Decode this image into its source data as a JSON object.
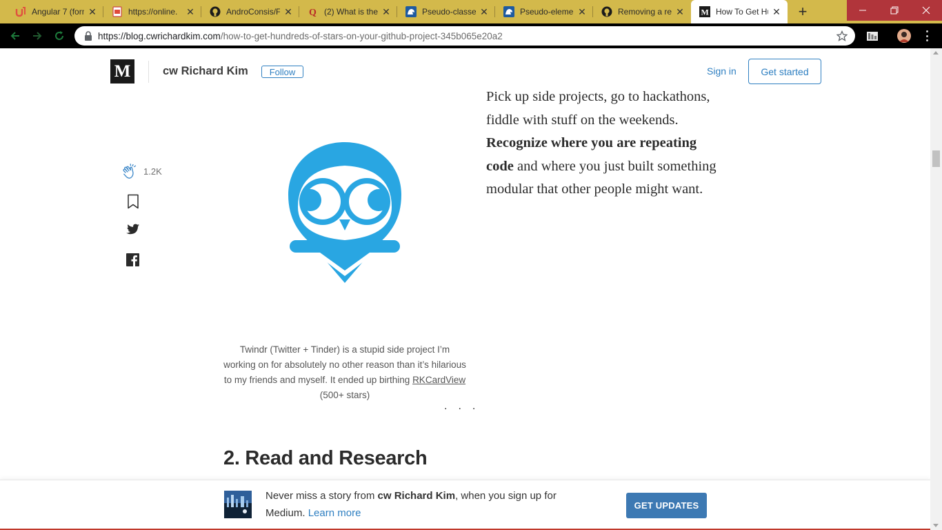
{
  "browser": {
    "tabs": [
      {
        "label": "Angular 7 (form",
        "favicon": "udemy-icon",
        "active": false
      },
      {
        "label": "https://online.",
        "favicon": "pdf-icon",
        "active": false
      },
      {
        "label": "AndroConsis/F",
        "favicon": "github-icon",
        "active": false
      },
      {
        "label": "(2) What is the",
        "favicon": "quora-icon",
        "active": false
      },
      {
        "label": "Pseudo-classes",
        "favicon": "mdn-icon",
        "active": false
      },
      {
        "label": "Pseudo-eleme",
        "favicon": "mdn-icon",
        "active": false
      },
      {
        "label": "Removing a re",
        "favicon": "github-icon",
        "active": false
      },
      {
        "label": "How To Get Hu",
        "favicon": "medium-icon",
        "active": true
      }
    ],
    "url_host": "https://blog.cwrichardkim.com",
    "url_path": "/how-to-get-hundreds-of-stars-on-your-github-project-345b065e20a2",
    "colors": {
      "tabstrip": "#d3b94b",
      "toolbar": "#000000",
      "window_controls": "#b1353b"
    }
  },
  "header": {
    "logo_letter": "M",
    "publication": "cw Richard Kim",
    "follow_label": "Follow",
    "signin_label": "Sign in",
    "getstarted_label": "Get started"
  },
  "rail": {
    "clap_count": "1.2K"
  },
  "article": {
    "body_p1": "Pick up side projects, go to hackathons, fiddle with stuff on the weekends.",
    "body_bold": "Recognize where you are repeating code",
    "body_p2": "and where you just built something modular that other people might want.",
    "caption_line": "Twindr (Twitter + Tinder) is a stupid side project I’m working on for absolutely no other reason than it’s hilarious to my friends and myself. It ended up birthing",
    "caption_link": "RKCardView",
    "caption_tail": "(500+ stars)",
    "separator": "...",
    "section_heading": "2. Read and Research"
  },
  "footer": {
    "text_pre": "Never miss a story from",
    "author": "cw Richard Kim",
    "text_post": ", when you sign up for Medium.",
    "learn_more": "Learn more",
    "cta_label": "GET UPDATES"
  },
  "colors": {
    "accent": "#2e7fc1",
    "owl": "#29a6e2",
    "cta": "#3d79b3"
  }
}
